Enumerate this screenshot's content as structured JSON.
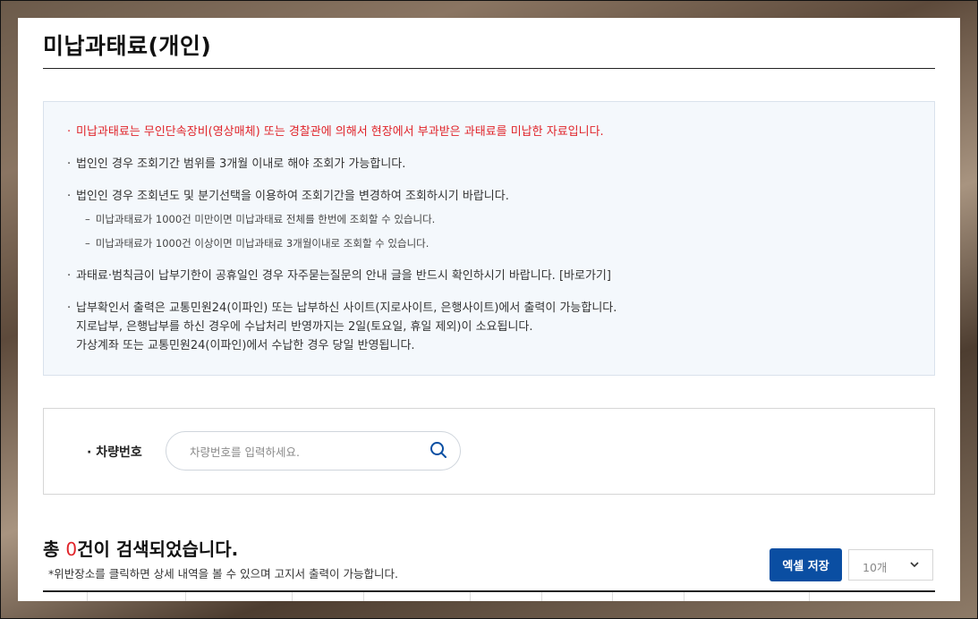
{
  "page": {
    "title": "미납과태료(개인)"
  },
  "notice": {
    "items": [
      {
        "text": "미납과태료는 무인단속장비(영상매체) 또는 경찰관에 의해서 현장에서 부과받은 과태료를 미납한 자료입니다.",
        "highlight": true
      },
      {
        "text": "법인인 경우 조회기간 범위를 3개월 이내로 해야 조회가 가능합니다."
      },
      {
        "text": "법인인 경우 조회년도 및 분기선택을 이용하여 조회기간을 변경하여 조회하시기 바랍니다."
      },
      {
        "text": "과태료·범칙금이 납부기한이 공휴일인 경우 자주묻는질문의 안내 글을 반드시 확인하시기 바랍니다. [바로가기]"
      },
      {
        "text": "납부확인서 출력은 교통민원24(이파인) 또는 납부하신 사이트(지로사이트, 은행사이트)에서 출력이 가능합니다."
      }
    ],
    "sub_items": [
      "미납과태료가 1000건 미만이면 미납과태료 전체를 한번에 조회할 수 있습니다.",
      "미납과태료가 1000건 이상이면 미납과태료 3개월이내로 조회할 수 있습니다."
    ],
    "continuation": [
      "지로납부, 은행납부를 하신 경우에 수납처리 반영까지는 2일(토요일, 휴일 제외)이 소요됩니다.",
      "가상계좌 또는 교통민원24(이파인)에서 수납한 경우 당일 반영됩니다."
    ]
  },
  "search": {
    "label": "차량번호",
    "input_value": "",
    "placeholder": "차량번호를 입력하세요.",
    "icon": "search-icon"
  },
  "results": {
    "prefix": "총 ",
    "count": "0",
    "suffix": "건이 검색되었습니다.",
    "note": "*위반장소를 클릭하면 상세 내역을 볼 수 있으며 고지서 출력이 가능합니다."
  },
  "toolbar": {
    "excel_label": "엑셀 저장",
    "page_size": "10개"
  },
  "colors": {
    "accent": "#0a4ea2",
    "alert": "#e0242a"
  }
}
